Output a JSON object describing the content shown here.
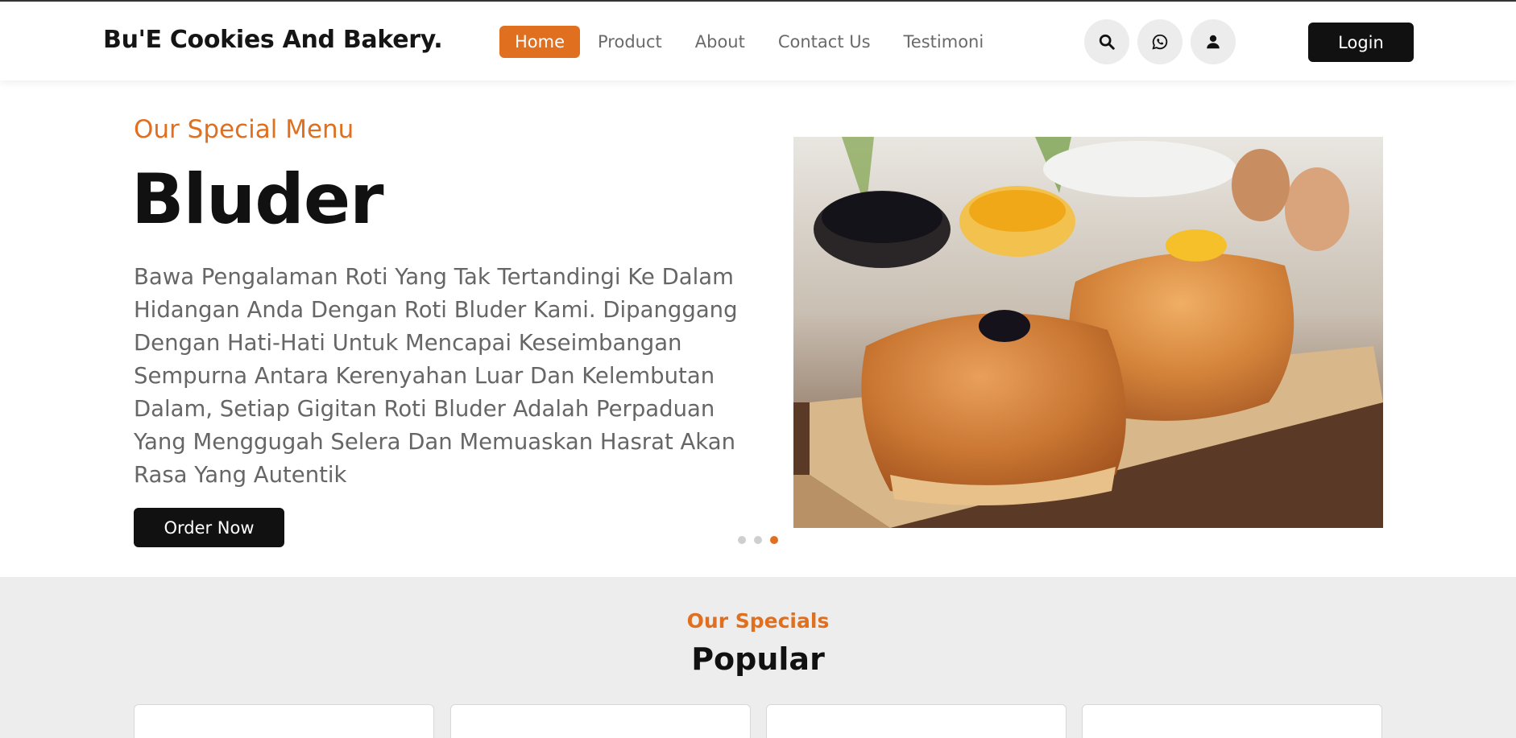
{
  "header": {
    "brand": "Bu'E Cookies And Bakery.",
    "nav": [
      {
        "label": "Home",
        "active": true
      },
      {
        "label": "Product"
      },
      {
        "label": "About"
      },
      {
        "label": "Contact Us"
      },
      {
        "label": "Testimoni"
      }
    ],
    "icons": [
      "search-icon",
      "whatsapp-icon",
      "user-icon"
    ],
    "login_label": "Login"
  },
  "hero": {
    "subtitle": "Our Special Menu",
    "title": "Bluder",
    "description": "Bawa Pengalaman Roti Yang Tak Tertandingi Ke Dalam Hidangan Anda Dengan Roti Bluder Kami. Dipanggang Dengan Hati-Hati Untuk Mencapai Keseimbangan Sempurna Antara Kerenyahan Luar Dan Kelembutan Dalam, Setiap Gigitan Roti Bluder Adalah Perpaduan Yang Menggugah Selera Dan Memuaskan Hasrat Akan Rasa Yang Autentik",
    "order_label": "Order Now",
    "carousel_total": 3,
    "carousel_active": 3
  },
  "specials": {
    "subtitle": "Our Specials",
    "title": "Popular"
  },
  "colors": {
    "accent": "#e0701f",
    "dark": "#111111",
    "section_bg": "#ededed"
  }
}
